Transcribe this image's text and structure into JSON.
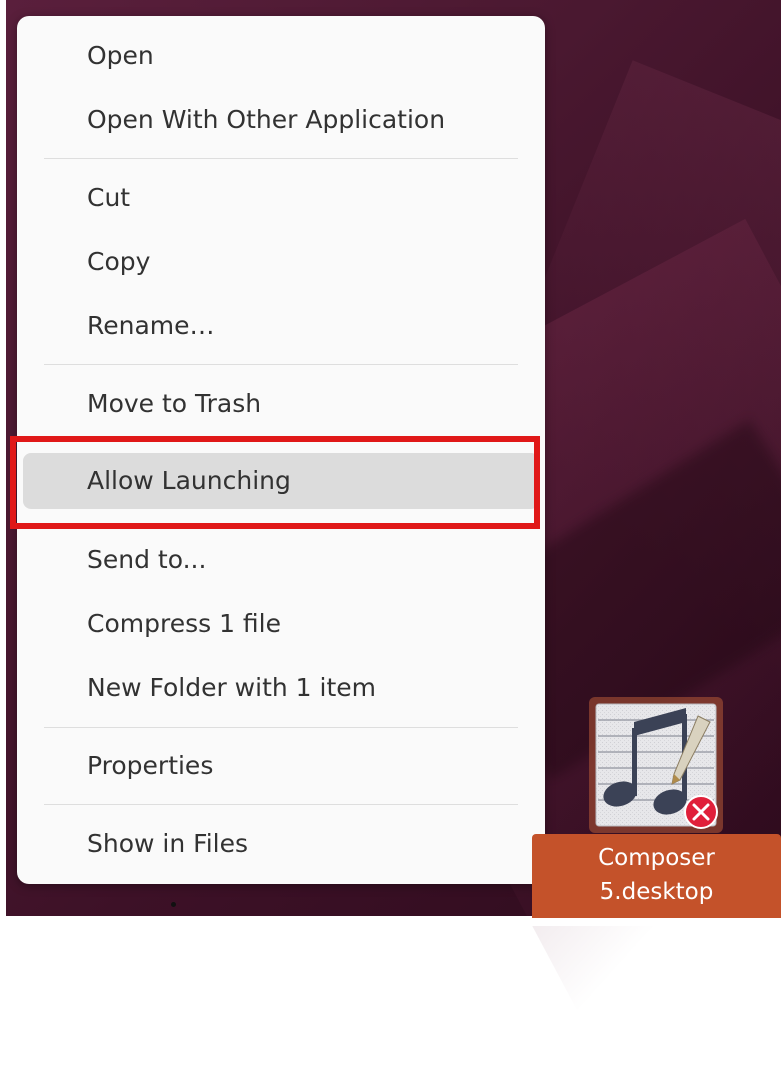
{
  "context_menu": {
    "items": [
      {
        "label": "Open"
      },
      {
        "label": "Open With Other Application"
      },
      {
        "label": "Cut"
      },
      {
        "label": "Copy"
      },
      {
        "label": "Rename…"
      },
      {
        "label": "Move to Trash"
      },
      {
        "label": "Allow Launching",
        "state": "hovered",
        "highlighted": true
      },
      {
        "label": "Send to..."
      },
      {
        "label": "Compress 1 file"
      },
      {
        "label": "New Folder with 1 item"
      },
      {
        "label": "Properties"
      },
      {
        "label": "Show in Files"
      }
    ]
  },
  "desktop_icon": {
    "name_line1": "Composer",
    "name_line2": "5.desktop",
    "icon": "music-composer-icon",
    "badge": "untrusted-x-badge"
  },
  "colors": {
    "menu_bg": "#fafafa",
    "hover_bg": "#dcdcdc",
    "highlight_border": "#e01818",
    "selection_label": "#c4522a",
    "badge": "#e0203a"
  }
}
